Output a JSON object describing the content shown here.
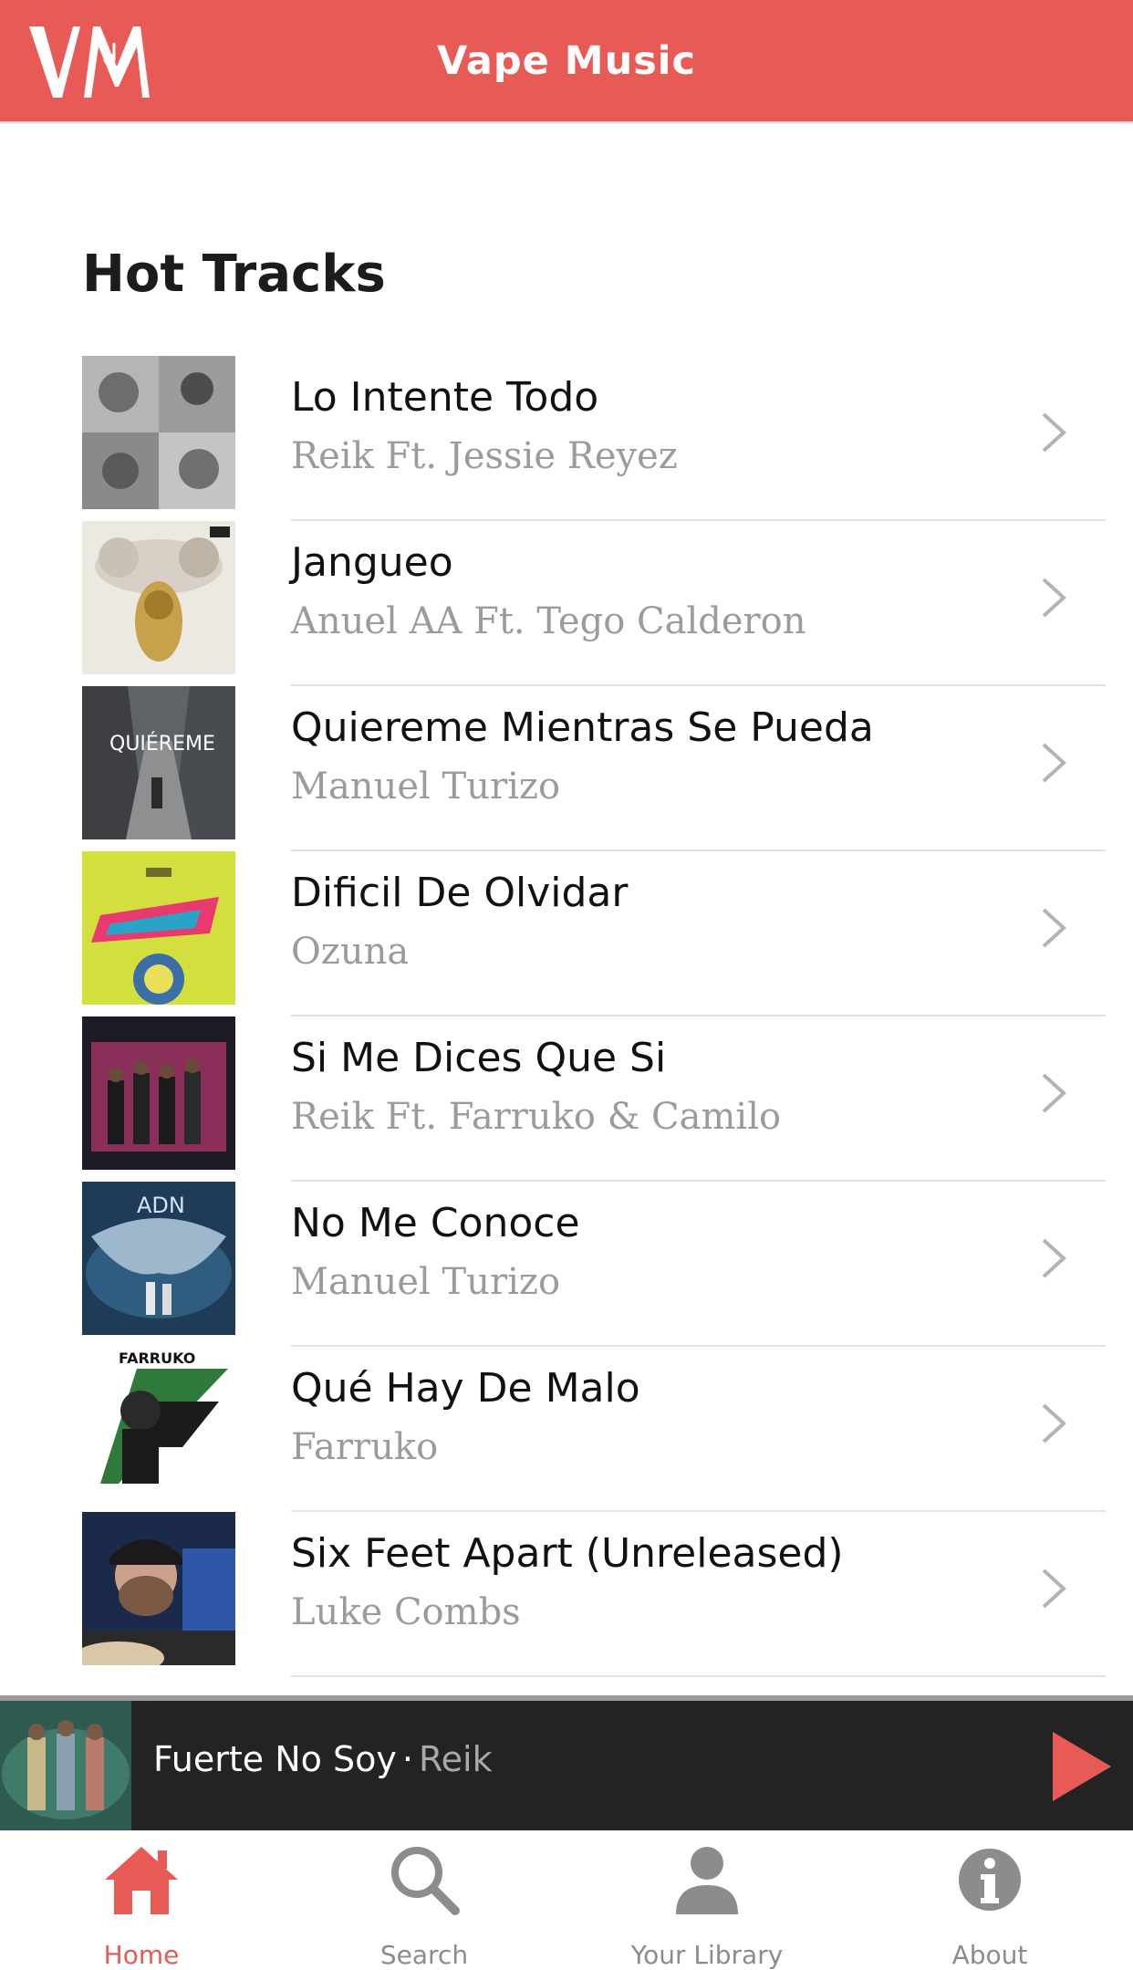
{
  "header": {
    "title": "Vape Music",
    "logo_text": "VM"
  },
  "section_title": "Hot Tracks",
  "tracks": [
    {
      "title": "Lo Intente Todo",
      "artist": "Reik Ft. Jessie Reyez"
    },
    {
      "title": "Jangueo",
      "artist": "Anuel AA Ft. Tego Calderon"
    },
    {
      "title": "Quiereme Mientras Se Pueda",
      "artist": "Manuel Turizo"
    },
    {
      "title": "Dificil De Olvidar",
      "artist": "Ozuna"
    },
    {
      "title": "Si Me Dices Que Si",
      "artist": "Reik Ft. Farruko & Camilo"
    },
    {
      "title": "No Me Conoce",
      "artist": "Manuel Turizo"
    },
    {
      "title": "Qué Hay De Malo",
      "artist": "Farruko"
    },
    {
      "title": "Six Feet Apart (Unreleased)",
      "artist": "Luke Combs"
    }
  ],
  "now_playing": {
    "title": "Fuerte No Soy",
    "separator": "·",
    "artist": "Reik"
  },
  "nav": [
    {
      "label": "Home",
      "icon": "home-icon",
      "active": true
    },
    {
      "label": "Search",
      "icon": "search-icon",
      "active": false
    },
    {
      "label": "Your Library",
      "icon": "user-icon",
      "active": false
    },
    {
      "label": "About",
      "icon": "info-icon",
      "active": false
    }
  ],
  "colors": {
    "accent": "#e85a55",
    "player_bg": "#232323",
    "secondary_text": "#9b9b9b"
  }
}
